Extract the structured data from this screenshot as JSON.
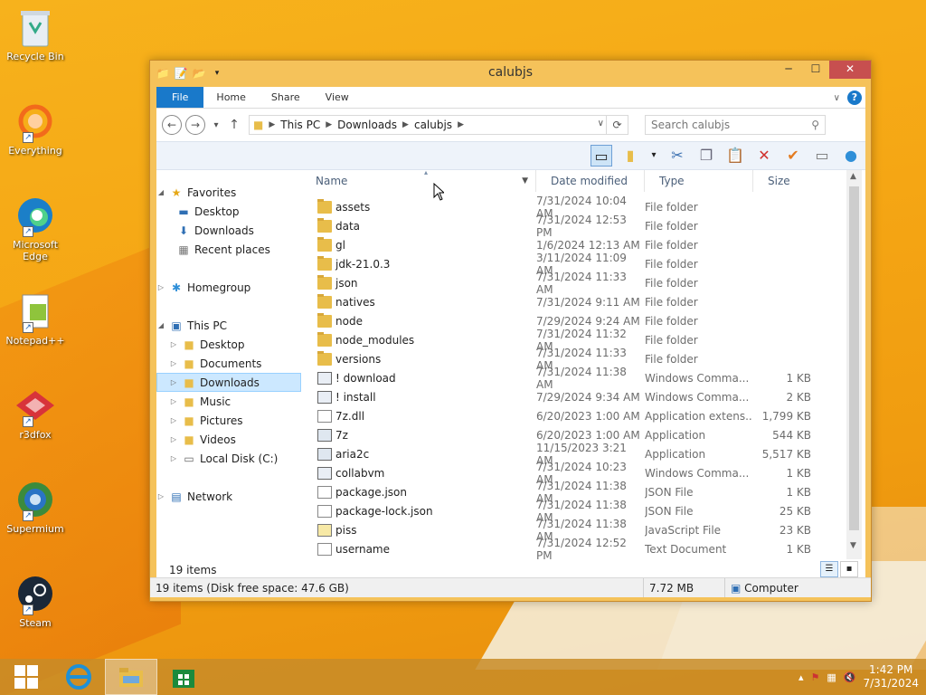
{
  "desktop": {
    "icons": [
      {
        "label": "Recycle Bin",
        "icon": "recycle-bin-icon"
      },
      {
        "label": "Everything",
        "icon": "everything-icon"
      },
      {
        "label": "Microsoft Edge",
        "icon": "edge-icon"
      },
      {
        "label": "Notepad++",
        "icon": "notepadpp-icon"
      },
      {
        "label": "r3dfox",
        "icon": "r3dfox-icon"
      },
      {
        "label": "Supermium",
        "icon": "supermium-icon"
      },
      {
        "label": "Steam",
        "icon": "steam-icon"
      }
    ]
  },
  "window": {
    "title": "calubjs",
    "controls": {
      "minimize": "─",
      "maximize": "☐",
      "close": "✕"
    },
    "ribbon_tabs": [
      "File",
      "Home",
      "Share",
      "View"
    ],
    "help": "?",
    "address": {
      "segments": [
        "This PC",
        "Downloads",
        "calubjs"
      ]
    },
    "search": {
      "placeholder": "Search calubjs"
    },
    "nav": {
      "favorites": "Favorites",
      "fav_items": [
        "Desktop",
        "Downloads",
        "Recent places"
      ],
      "homegroup": "Homegroup",
      "thispc": "This PC",
      "pc_items": [
        "Desktop",
        "Documents",
        "Downloads",
        "Music",
        "Pictures",
        "Videos",
        "Local Disk (C:)"
      ],
      "network": "Network"
    },
    "columns": {
      "name": "Name",
      "date": "Date modified",
      "type": "Type",
      "size": "Size"
    },
    "files": [
      {
        "name": "assets",
        "date": "7/31/2024 10:04 AM",
        "type": "File folder",
        "size": "",
        "kind": "folder"
      },
      {
        "name": "data",
        "date": "7/31/2024 12:53 PM",
        "type": "File folder",
        "size": "",
        "kind": "folder"
      },
      {
        "name": "gl",
        "date": "1/6/2024 12:13 AM",
        "type": "File folder",
        "size": "",
        "kind": "folder"
      },
      {
        "name": "jdk-21.0.3",
        "date": "3/11/2024 11:09 AM",
        "type": "File folder",
        "size": "",
        "kind": "folder"
      },
      {
        "name": "json",
        "date": "7/31/2024 11:33 AM",
        "type": "File folder",
        "size": "",
        "kind": "folder"
      },
      {
        "name": "natives",
        "date": "7/31/2024 9:11 AM",
        "type": "File folder",
        "size": "",
        "kind": "folder"
      },
      {
        "name": "node",
        "date": "7/29/2024 9:24 AM",
        "type": "File folder",
        "size": "",
        "kind": "folder"
      },
      {
        "name": "node_modules",
        "date": "7/31/2024 11:32 AM",
        "type": "File folder",
        "size": "",
        "kind": "folder"
      },
      {
        "name": "versions",
        "date": "7/31/2024 11:33 AM",
        "type": "File folder",
        "size": "",
        "kind": "folder"
      },
      {
        "name": "! download",
        "date": "7/31/2024 11:38 AM",
        "type": "Windows Comma...",
        "size": "1 KB",
        "kind": "cmd"
      },
      {
        "name": "! install",
        "date": "7/29/2024 9:34 AM",
        "type": "Windows Comma...",
        "size": "2 KB",
        "kind": "cmd"
      },
      {
        "name": "7z.dll",
        "date": "6/20/2023 1:00 AM",
        "type": "Application extens...",
        "size": "1,799 KB",
        "kind": "doc"
      },
      {
        "name": "7z",
        "date": "6/20/2023 1:00 AM",
        "type": "Application",
        "size": "544 KB",
        "kind": "app"
      },
      {
        "name": "aria2c",
        "date": "11/15/2023 3:21 AM",
        "type": "Application",
        "size": "5,517 KB",
        "kind": "app"
      },
      {
        "name": "collabvm",
        "date": "7/31/2024 10:23 AM",
        "type": "Windows Comma...",
        "size": "1 KB",
        "kind": "cmd"
      },
      {
        "name": "package.json",
        "date": "7/31/2024 11:38 AM",
        "type": "JSON File",
        "size": "1 KB",
        "kind": "doc"
      },
      {
        "name": "package-lock.json",
        "date": "7/31/2024 11:38 AM",
        "type": "JSON File",
        "size": "25 KB",
        "kind": "doc"
      },
      {
        "name": "piss",
        "date": "7/31/2024 11:38 AM",
        "type": "JavaScript File",
        "size": "23 KB",
        "kind": "js"
      },
      {
        "name": "username",
        "date": "7/31/2024 12:52 PM",
        "type": "Text Document",
        "size": "1 KB",
        "kind": "doc"
      }
    ],
    "item_count": "19 items",
    "status": {
      "items": "19 items (Disk free space: 47.6 GB)",
      "size": "7.72 MB",
      "location": "Computer"
    }
  },
  "taskbar": {
    "clock_time": "1:42 PM",
    "clock_date": "7/31/2024"
  }
}
